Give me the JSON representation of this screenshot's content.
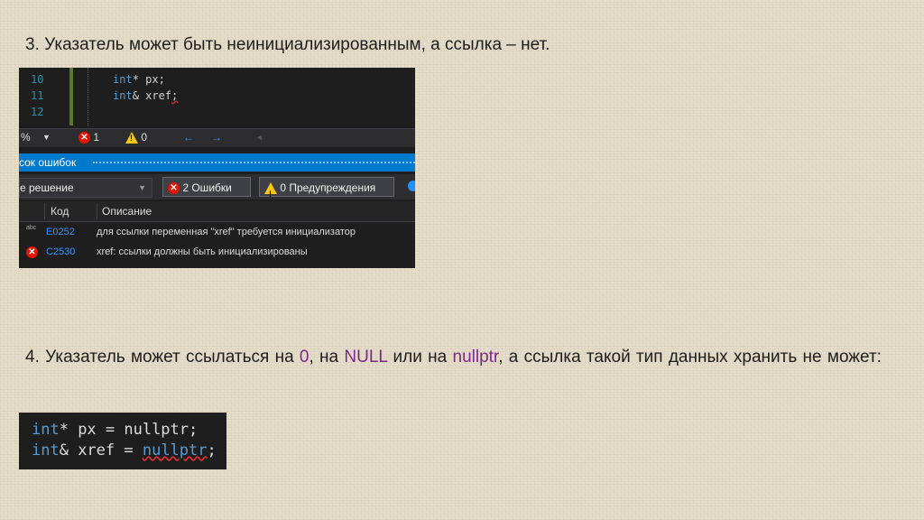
{
  "slide": {
    "point3": "3. Указатель может быть неинициализированным, а ссылка – нет.",
    "point4": {
      "part1": "4. Указатель может ссылаться на ",
      "zero": "0",
      "part2": ", на ",
      "null": "NULL",
      "part3": " или на ",
      "nullptr": "nullptr",
      "part4": ", а ссылка такой тип данных хранить не может:"
    },
    "highlight_color": "#7a2a8a"
  },
  "editor": {
    "lines": [
      {
        "num": "10",
        "kw": "int",
        "rest": "* px;"
      },
      {
        "num": "11",
        "kw": "int",
        "rest": "& xref",
        "err": ";"
      },
      {
        "num": "12",
        "kw": "",
        "rest": ""
      }
    ],
    "status": {
      "zoom": "%",
      "errors": "1",
      "warnings": "0"
    }
  },
  "error_list": {
    "title": "сок ошибок",
    "scope": "е решение",
    "errors_button": "2 Ошибки",
    "warnings_button": "0 Предупреждения",
    "columns": [
      "Код",
      "Описание"
    ],
    "rows": [
      {
        "code": "E0252",
        "icon": "intellisense-error-icon",
        "desc": "для ссылки переменная \"xref\" требуется инициализатор"
      },
      {
        "code": "C2530",
        "icon": "error-circle-icon",
        "desc": "xref: ссылки должны быть инициализированы"
      }
    ]
  },
  "snippet": {
    "line1": {
      "kw": "int",
      "rest": "* px = nullptr;"
    },
    "line2": {
      "kw": "int",
      "rest": "& xref = ",
      "err": "nullptr",
      "tail": ";"
    }
  },
  "icon_abc": "abc",
  "error_glyph": "✕",
  "warn_glyph": "!",
  "arrows": {
    "back": "←",
    "fwd": "→",
    "left": "◄"
  },
  "chevron": "▼"
}
